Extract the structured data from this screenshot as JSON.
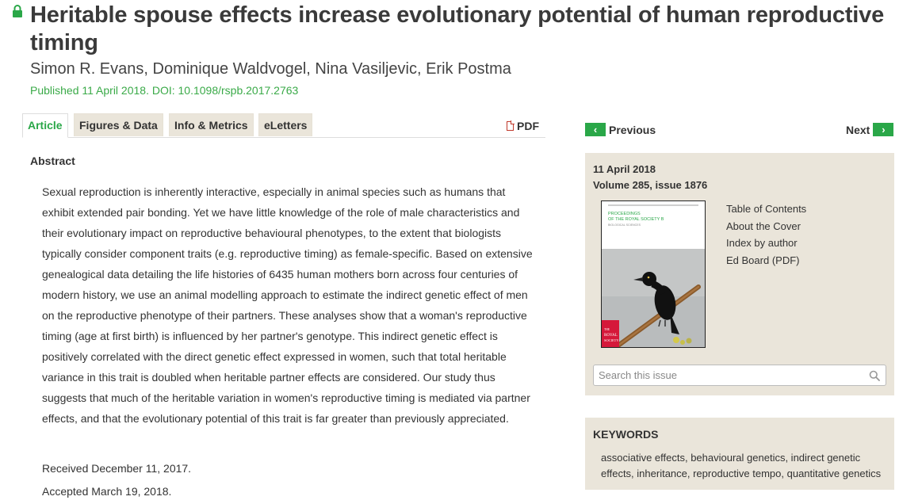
{
  "article": {
    "title": "Heritable spouse effects increase evolutionary potential of human reproductive timing",
    "authors": "Simon R. Evans, Dominique Waldvogel, Nina Vasiljevic, Erik Postma",
    "published": "Published 11 April 2018. DOI: 10.1098/rspb.2017.2763"
  },
  "tabs": [
    "Article",
    "Figures & Data",
    "Info & Metrics",
    "eLetters"
  ],
  "pdf_label": "PDF",
  "abstract": {
    "heading": "Abstract",
    "text": "Sexual reproduction is inherently interactive, especially in animal species such as humans that exhibit extended pair bonding. Yet we have little knowledge of the role of male characteristics and their evolutionary impact on reproductive behavioural phenotypes, to the extent that biologists typically consider component traits (e.g. reproductive timing) as female-specific. Based on extensive genealogical data detailing the life histories of 6435 human mothers born across four centuries of modern history, we use an animal modelling approach to estimate the indirect genetic effect of men on the reproductive phenotype of their partners. These analyses show that a woman's reproductive timing (age at first birth) is influenced by her partner's genotype. This indirect genetic effect is positively correlated with the direct genetic effect expressed in women, such that total heritable variance in this trait is doubled when heritable partner effects are considered. Our study thus suggests that much of the heritable variation in women's reproductive timing is mediated via partner effects, and that the evolutionary potential of this trait is far greater than previously appreciated.",
    "received": "Received December 11, 2017.",
    "accepted": "Accepted March 19, 2018."
  },
  "nav": {
    "previous": "Previous",
    "next": "Next"
  },
  "issue": {
    "date": "11 April 2018",
    "volume": "Volume 285, issue 1876",
    "links": [
      "Table of Contents",
      "About the Cover",
      "Index by author",
      "Ed Board (PDF)"
    ],
    "cover": {
      "journal_line1": "PROCEEDINGS",
      "journal_line2": "OF THE ROYAL SOCIETY B",
      "subtitle": "BIOLOGICAL SCIENCES",
      "publisher_line1": "THE",
      "publisher_line2": "ROYAL",
      "publisher_line3": "SOCIETY"
    },
    "search_placeholder": "Search this issue"
  },
  "keywords": {
    "heading": "KEYWORDS",
    "text": "associative effects, behavioural genetics, indirect genetic effects, inheritance, reproductive tempo, quantitative genetics"
  },
  "colors": {
    "accent_green": "#2aa748",
    "panel_beige": "#eae5da",
    "pdf_red": "#c0392b"
  }
}
